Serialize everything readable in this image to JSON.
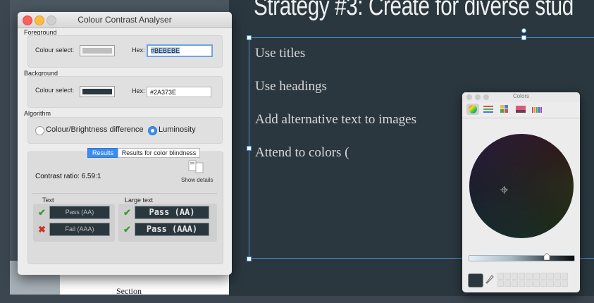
{
  "slide": {
    "title": "Strategy #3: Create for diverse stud",
    "bullets": [
      "Use titles",
      "Use headings",
      "Add alternative text to images",
      "Attend to colors ("
    ]
  },
  "document": {
    "section_label": "Section"
  },
  "cca": {
    "window_title": "Colour Contrast Analyser",
    "foreground": {
      "heading": "Foreground",
      "select_label": "Colour select:",
      "hex_label": "Hex:",
      "hex_value": "#BEBEBE",
      "color": "#BEBEBE"
    },
    "background": {
      "heading": "Background",
      "select_label": "Colour select:",
      "hex_label": "Hex:",
      "hex_value": "#2A373E",
      "color": "#2A373E"
    },
    "algorithm": {
      "heading": "Algorithm",
      "options": [
        "Colour/Brightness difference",
        "Luminosity"
      ],
      "selected": "Luminosity"
    },
    "results": {
      "tabs": [
        "Results",
        "Results for color blindness"
      ],
      "active_tab": "Results",
      "contrast_ratio": "Contrast ratio: 6.59:1",
      "show_details": "Show details",
      "text_heading": "Text",
      "large_text_heading": "Large text",
      "text_aa": "Pass (AA)",
      "text_aaa": "Fail (AAA)",
      "large_aa": "Pass (AA)",
      "large_aaa": "Pass (AAA)"
    }
  },
  "colors_panel": {
    "title": "Colors",
    "toolbar": [
      "color-wheel-icon",
      "color-sliders-icon",
      "color-palettes-icon",
      "image-palettes-icon",
      "crayons-icon"
    ],
    "current_color": "#2A373E"
  }
}
